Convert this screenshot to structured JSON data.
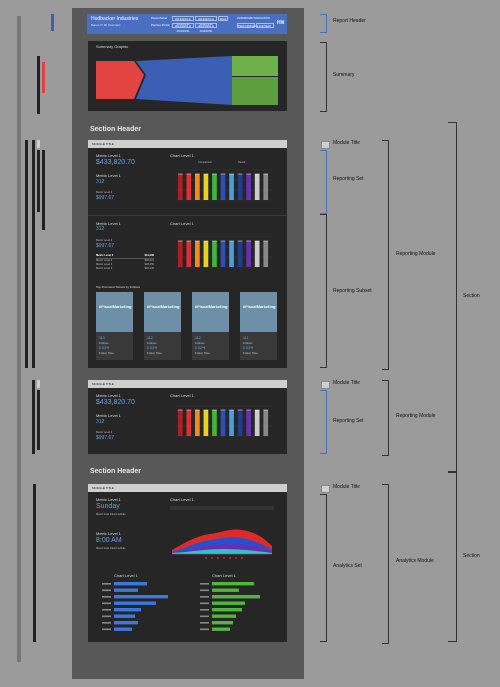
{
  "report_header": {
    "title": "Hudbacker Industries",
    "subtitle": "Bacon IT MI Overview",
    "report_period_label": "Report Period",
    "previous_period_label": "Previous Period",
    "date_a": "2013/11/01 to 2013/11/30",
    "date_b": "2013/11/01 to 2013/11/30",
    "date_c": "2013/10/01 to 2013/10/31",
    "date_d": "2013/10/01 to 2013/10/31",
    "week_btn": "Week",
    "nav_label": "DASHBOARD NAVIGATION",
    "nav_btn_1": "PERFORMANCE",
    "nav_btn_2": "CONTENT",
    "logo": "HN"
  },
  "summary": {
    "title": "Summary Graphic",
    "colors": [
      "#e24444",
      "#3a5fb5",
      "#6fb04a"
    ]
  },
  "section_headers": [
    "Section Header",
    "Section Header"
  ],
  "module1": {
    "title": "MODULE TITLE",
    "metric1_label": "Metric Level 1",
    "metric1_value": "$433,820.70",
    "metric2_label": "Metric Level 1",
    "metric2_value": "312",
    "metric3_label": "Metric Level 2",
    "metric3_value": "$997.67",
    "chart_title": "Chart Level 1",
    "legend_a": "Comparison",
    "legend_b": "Result",
    "subset": {
      "metric1_label": "Metric Level 1",
      "metric1_value": "312",
      "metric2_label": "Metric Level 2",
      "metric2_value": "$997.67",
      "chart_title": "Chart Level 1",
      "table": [
        {
          "k": "Metric Level 3",
          "v": "$31,908"
        },
        {
          "k": "Metric Level 4",
          "v": "$30,021"
        },
        {
          "k": "Metric Level 4",
          "v": "$28,455"
        },
        {
          "k": "Metric Level 4",
          "v": "$26,130"
        }
      ],
      "promo_title": "Top Promoted Tweets by Follows",
      "cards": [
        {
          "brand": "#FiscalMarketing",
          "v1": "113",
          "l1": "Follows",
          "v2": "0.03%",
          "l2": "Follow Rate"
        },
        {
          "brand": "#FiscalMarketing",
          "v1": "112",
          "l1": "Follows",
          "v2": "0.03%",
          "l2": "Follow Rate"
        },
        {
          "brand": "#FiscalMarketing",
          "v1": "112",
          "l1": "Follows",
          "v2": "0.02%",
          "l2": "Follow Rate"
        },
        {
          "brand": "#FiscalMarketing",
          "v1": "111",
          "l1": "Follows",
          "v2": "0.03%",
          "l2": "Follow Rate"
        }
      ]
    }
  },
  "module2": {
    "title": "MODULE TITLE",
    "metric1_label": "Metric Level 1",
    "metric1_value": "$433,820.70",
    "metric2_label": "Metric Level 1",
    "metric2_value": "312",
    "metric3_label": "Metric Level 2",
    "metric3_value": "$997.67",
    "chart_title": "Chart Level 1"
  },
  "module3": {
    "title": "MODULE TITLE",
    "metric1_label": "Metric Level 1",
    "metric1_value": "Sunday",
    "metric1_note": "Metric level linked subtitle",
    "metric2_label": "Metric Level 1",
    "metric2_value": "8:00 AM",
    "metric2_note": "Metric level linked subtitle",
    "chart_title": "Chart Level 1",
    "hbar_left_title": "Chart Level 1",
    "hbar_right_title": "Chart Level 1"
  },
  "annotations": {
    "report_header": "Report Header",
    "summary": "Summary",
    "module_title_1": "Module Title",
    "reporting_set_1": "Reporting Set",
    "reporting_subset": "Reporting Subset",
    "reporting_module_1": "Reporting Module",
    "section_1": "Section",
    "module_title_2": "Module Title",
    "reporting_set_2": "Reporting Set",
    "reporting_module_2": "Reporting Module",
    "module_title_3": "Module Title",
    "analytics_set": "Analytics Set",
    "analytics_module": "Analytics Module",
    "section_2": "Section"
  },
  "chart_data": [
    {
      "type": "bar",
      "colors": [
        "#b01f1f",
        "#e03030",
        "#f08c1a",
        "#e8d21e",
        "#3fb83a",
        "#2a4fb8",
        "#4f9be0",
        "#253b8a",
        "#6a2fb0",
        "#cccccc",
        "#888888"
      ]
    },
    {
      "type": "area",
      "series": [
        "#e02a2a",
        "#2a4fcc",
        "#6a2fb0",
        "#2ec4c4"
      ]
    },
    {
      "type": "bar",
      "orientation": "horizontal",
      "values": [
        0.55,
        0.4,
        0.9,
        0.7,
        0.45,
        0.35,
        0.4,
        0.3
      ],
      "color": "#3a7ae0"
    },
    {
      "type": "bar",
      "orientation": "horizontal",
      "values": [
        0.7,
        0.45,
        0.8,
        0.55,
        0.5,
        0.4,
        0.35,
        0.3
      ],
      "color": "#4fb83a"
    }
  ]
}
